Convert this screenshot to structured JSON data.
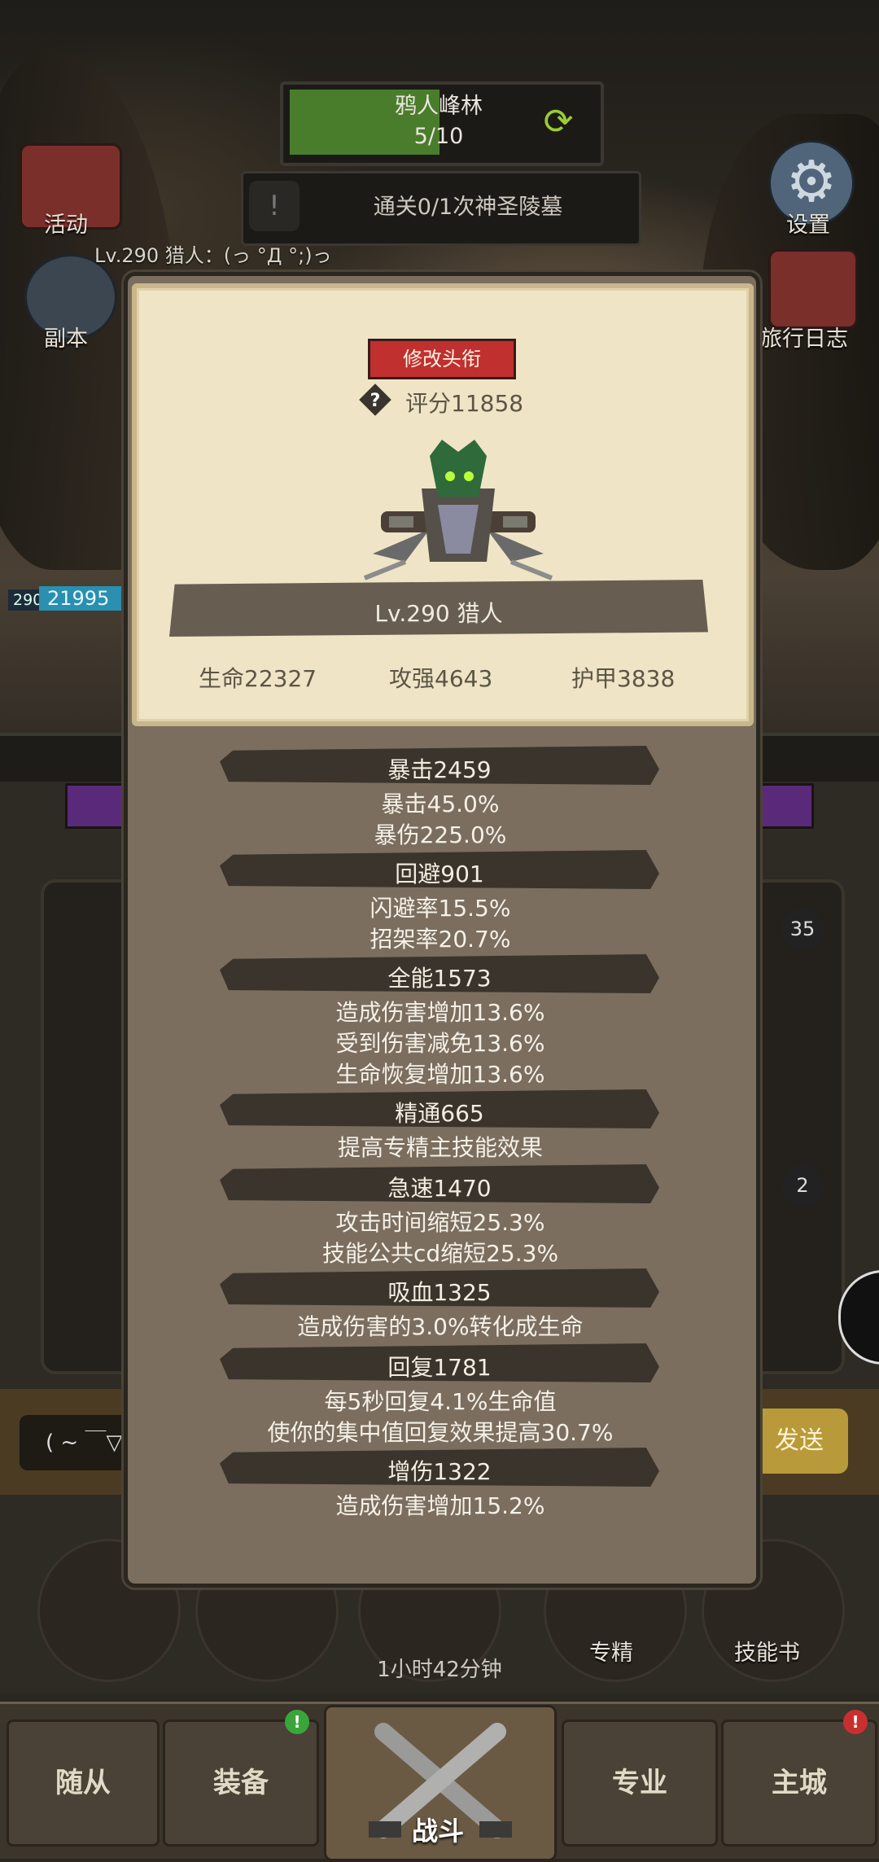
{
  "stage": {
    "name": "鸦人峰林",
    "progress": "5/10",
    "progress_fraction": 0.5
  },
  "quest": {
    "text": "通关0/1次神圣陵墓"
  },
  "left_menu": [
    {
      "label": "活动",
      "icon": "activity-icon"
    },
    {
      "label": "副本",
      "icon": "dungeon-icon"
    }
  ],
  "right_menu": [
    {
      "label": "设置",
      "icon": "gear-icon"
    },
    {
      "label": "旅行日志",
      "icon": "journal-icon"
    }
  ],
  "character_line": "Lv.290 猎人：(っ °Д °;)っ",
  "hp": {
    "level": "290",
    "value": "21995"
  },
  "profile": {
    "title_button": "修改头衔",
    "score": "评分11858",
    "name": "Lv.290 猎人",
    "stats": {
      "hp": "生命22327",
      "attack": "攻强4643",
      "armor": "护甲3838"
    }
  },
  "sections": [
    {
      "title": "暴击2459",
      "lines": [
        "暴击45.0%",
        "暴伤225.0%"
      ]
    },
    {
      "title": "回避901",
      "lines": [
        "闪避率15.5%",
        "招架率20.7%"
      ]
    },
    {
      "title": "全能1573",
      "lines": [
        "造成伤害增加13.6%",
        "受到伤害减免13.6%",
        "生命恢复增加13.6%"
      ]
    },
    {
      "title": "精通665",
      "lines": [
        "提高专精主技能效果"
      ]
    },
    {
      "title": "急速1470",
      "lines": [
        "攻击时间缩短25.3%",
        "技能公共cd缩短25.3%"
      ]
    },
    {
      "title": "吸血1325",
      "lines": [
        "造成伤害的3.0%转化成生命"
      ]
    },
    {
      "title": "回复1781",
      "lines": [
        "每5秒回复4.1%生命值",
        "使你的集中值回复效果提高30.7%"
      ]
    },
    {
      "title": "增伤1322",
      "lines": [
        "造成伤害增加15.2%"
      ]
    }
  ],
  "background": {
    "item_counts": [
      "35",
      "2"
    ],
    "chat_prefix": "( ~ ￣▽",
    "send_label": "发送",
    "skill_labels": [
      "专精",
      "技能书"
    ],
    "timer": "1小时42分钟"
  },
  "bottom_nav": [
    {
      "label": "随从"
    },
    {
      "label": "装备",
      "badge": "!"
    },
    {
      "label": "战斗"
    },
    {
      "label": "专业"
    },
    {
      "label": "主城",
      "badge": "!"
    }
  ],
  "colors": {
    "stage_fill": "#4a7d2b",
    "title_button": "#c0302e",
    "card": "#efe5c6",
    "modal": "#7b6e5e",
    "section_bar": "#3a342c"
  }
}
